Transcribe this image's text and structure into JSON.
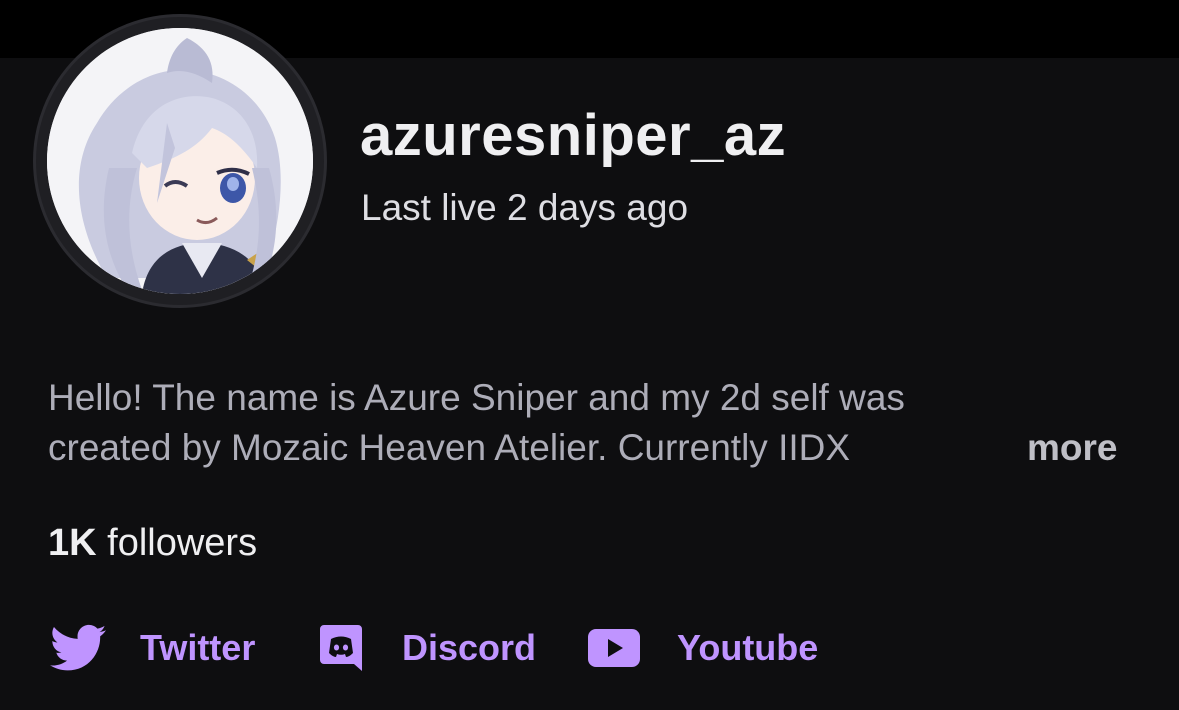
{
  "profile": {
    "username": "azuresniper_az",
    "last_live": "Last live 2 days ago",
    "bio_line1": "Hello! The name is Azure Sniper and my 2d self was",
    "bio_line2": "created by Mozaic Heaven Atelier. Currently IIDX",
    "more_label": "more",
    "followers_count": "1K",
    "followers_label": " followers"
  },
  "social_links": [
    {
      "label": "Twitter",
      "icon": "twitter-bird-icon"
    },
    {
      "label": "Discord",
      "icon": "discord-icon"
    },
    {
      "label": "Youtube",
      "icon": "youtube-play-icon"
    }
  ],
  "colors": {
    "background": "#0e0e10",
    "accent": "#bf94ff",
    "text_primary": "#efeff1",
    "text_muted": "#adadb8"
  }
}
